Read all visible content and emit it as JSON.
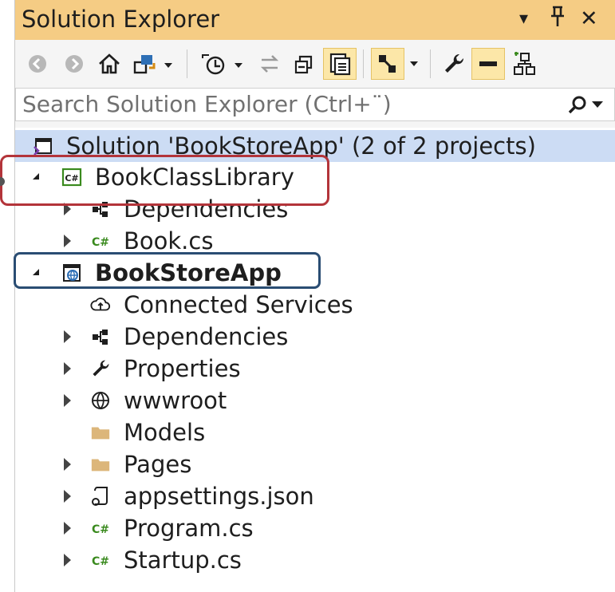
{
  "window": {
    "title": "Solution Explorer",
    "controls": {
      "dropdown": "▾",
      "pin": "🖈",
      "close": "✕"
    }
  },
  "toolbar": {
    "buttons": [
      {
        "name": "back-button",
        "icon": "back-icon"
      },
      {
        "name": "forward-button",
        "icon": "forward-icon"
      },
      {
        "name": "home-button",
        "icon": "home-icon"
      },
      {
        "name": "switch-views-button",
        "icon": "switch-views-icon"
      },
      {
        "name": "pending-changes-filter-button",
        "icon": "clock-icon"
      },
      {
        "name": "sync-with-active-document-button",
        "icon": "sync-icon"
      },
      {
        "name": "collapse-all-button",
        "icon": "collapse-all-icon"
      },
      {
        "name": "show-all-files-button",
        "icon": "show-all-files-icon"
      },
      {
        "name": "preview-selected-items-button",
        "icon": "preview-icon"
      },
      {
        "name": "properties-button",
        "icon": "wrench-icon"
      },
      {
        "name": "minimize-button",
        "icon": "minus-icon"
      },
      {
        "name": "view-class-diagram-button",
        "icon": "class-diagram-icon"
      }
    ]
  },
  "search": {
    "placeholder": "Search Solution Explorer (Ctrl+¨)"
  },
  "tree": {
    "solution": {
      "label": "Solution 'BookStoreApp' (2 of 2 projects)",
      "icon": "solution-icon"
    },
    "items": [
      {
        "label": "BookClassLibrary",
        "icon": "csharp-project-icon",
        "level": 1,
        "expander": "open",
        "bold": false
      },
      {
        "label": "Dependencies",
        "icon": "dependencies-icon",
        "level": 2,
        "expander": "closed",
        "bold": false
      },
      {
        "label": "Book.cs",
        "icon": "csharp-file-icon",
        "level": 2,
        "expander": "closed",
        "bold": false
      },
      {
        "label": "BookStoreApp",
        "icon": "web-project-icon",
        "level": 1,
        "expander": "open",
        "bold": true
      },
      {
        "label": "Connected Services",
        "icon": "connected-services-icon",
        "level": 2,
        "expander": "none",
        "bold": false
      },
      {
        "label": "Dependencies",
        "icon": "dependencies-icon",
        "level": 2,
        "expander": "closed",
        "bold": false
      },
      {
        "label": "Properties",
        "icon": "wrench-icon",
        "level": 2,
        "expander": "closed",
        "bold": false
      },
      {
        "label": "wwwroot",
        "icon": "globe-icon",
        "level": 2,
        "expander": "closed",
        "bold": false
      },
      {
        "label": "Models",
        "icon": "folder-icon",
        "level": 2,
        "expander": "none",
        "bold": false
      },
      {
        "label": "Pages",
        "icon": "folder-icon",
        "level": 2,
        "expander": "closed",
        "bold": false
      },
      {
        "label": "appsettings.json",
        "icon": "json-file-icon",
        "level": 2,
        "expander": "closed",
        "bold": false
      },
      {
        "label": "Program.cs",
        "icon": "csharp-file-icon",
        "level": 2,
        "expander": "closed",
        "bold": false
      },
      {
        "label": "Startup.cs",
        "icon": "csharp-file-icon",
        "level": 2,
        "expander": "closed",
        "bold": false
      }
    ]
  },
  "colors": {
    "titlebar": "#f5cc84",
    "selection": "#ccdcf4",
    "highlight_red": "#b3343a",
    "highlight_blue": "#2a4d73",
    "csharp_green": "#3a8a1e"
  }
}
